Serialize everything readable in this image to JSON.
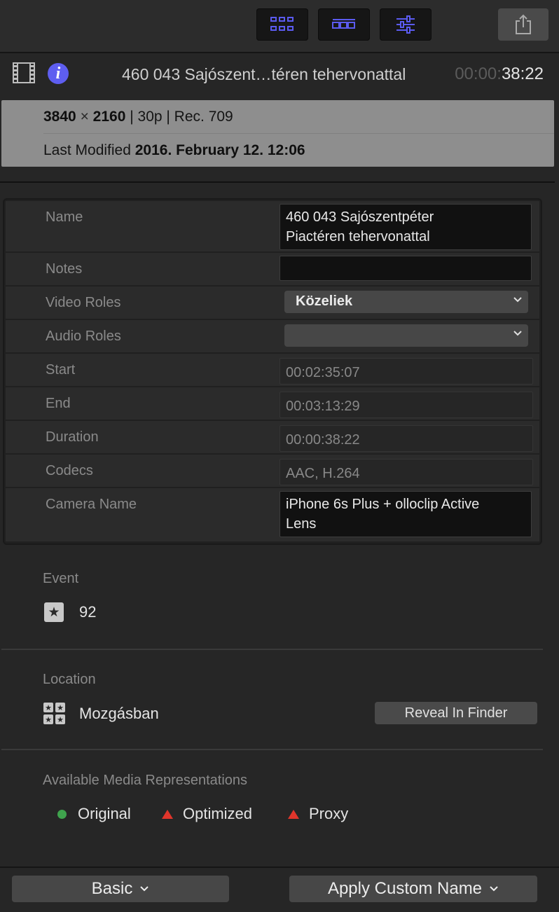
{
  "toolbar": {
    "buttons": [
      {
        "icon": "grid-view-icon",
        "color": "#5b5bf0"
      },
      {
        "icon": "filmstrip-view-icon",
        "color": "#5b5bf0"
      },
      {
        "icon": "inspector-sliders-icon",
        "color": "#5b5bf0"
      }
    ],
    "share_icon": "share-icon"
  },
  "header": {
    "clip_title": "460 043 Sajószent…téren tehervonattal",
    "timecode_dim": "00:00:",
    "timecode_bright": "38:22"
  },
  "summary": {
    "width": "3840",
    "times": "×",
    "height": "2160",
    "format_rest": "| 30p | Rec. 709",
    "last_modified_label": "Last Modified",
    "last_modified_value": "2016. February 12. 12:06"
  },
  "properties": {
    "name": {
      "label": "Name",
      "line1": "460 043 Sajószentpéter",
      "line2": "Piactéren tehervonattal"
    },
    "notes": {
      "label": "Notes",
      "value": ""
    },
    "video_roles": {
      "label": "Video Roles",
      "value": "Közeliek"
    },
    "audio_roles": {
      "label": "Audio Roles",
      "value": ""
    },
    "start": {
      "label": "Start",
      "value": "00:02:35:07"
    },
    "end": {
      "label": "End",
      "value": "00:03:13:29"
    },
    "duration": {
      "label": "Duration",
      "value": "00:00:38:22"
    },
    "codecs": {
      "label": "Codecs",
      "value": "AAC, H.264"
    },
    "camera_name": {
      "label": "Camera Name",
      "line1": "iPhone 6s Plus + olloclip Active",
      "line2": "Lens"
    }
  },
  "event": {
    "label": "Event",
    "value": "92"
  },
  "location": {
    "label": "Location",
    "value": "Mozgásban",
    "reveal_button": "Reveal In Finder"
  },
  "media": {
    "label": "Available Media Representations",
    "items": [
      {
        "label": "Original",
        "status": "available",
        "color": "#3fa34d"
      },
      {
        "label": "Optimized",
        "status": "missing",
        "color": "#e0352b"
      },
      {
        "label": "Proxy",
        "status": "missing",
        "color": "#e0352b"
      }
    ]
  },
  "footer": {
    "basic_label": "Basic",
    "apply_label": "Apply Custom Name"
  }
}
